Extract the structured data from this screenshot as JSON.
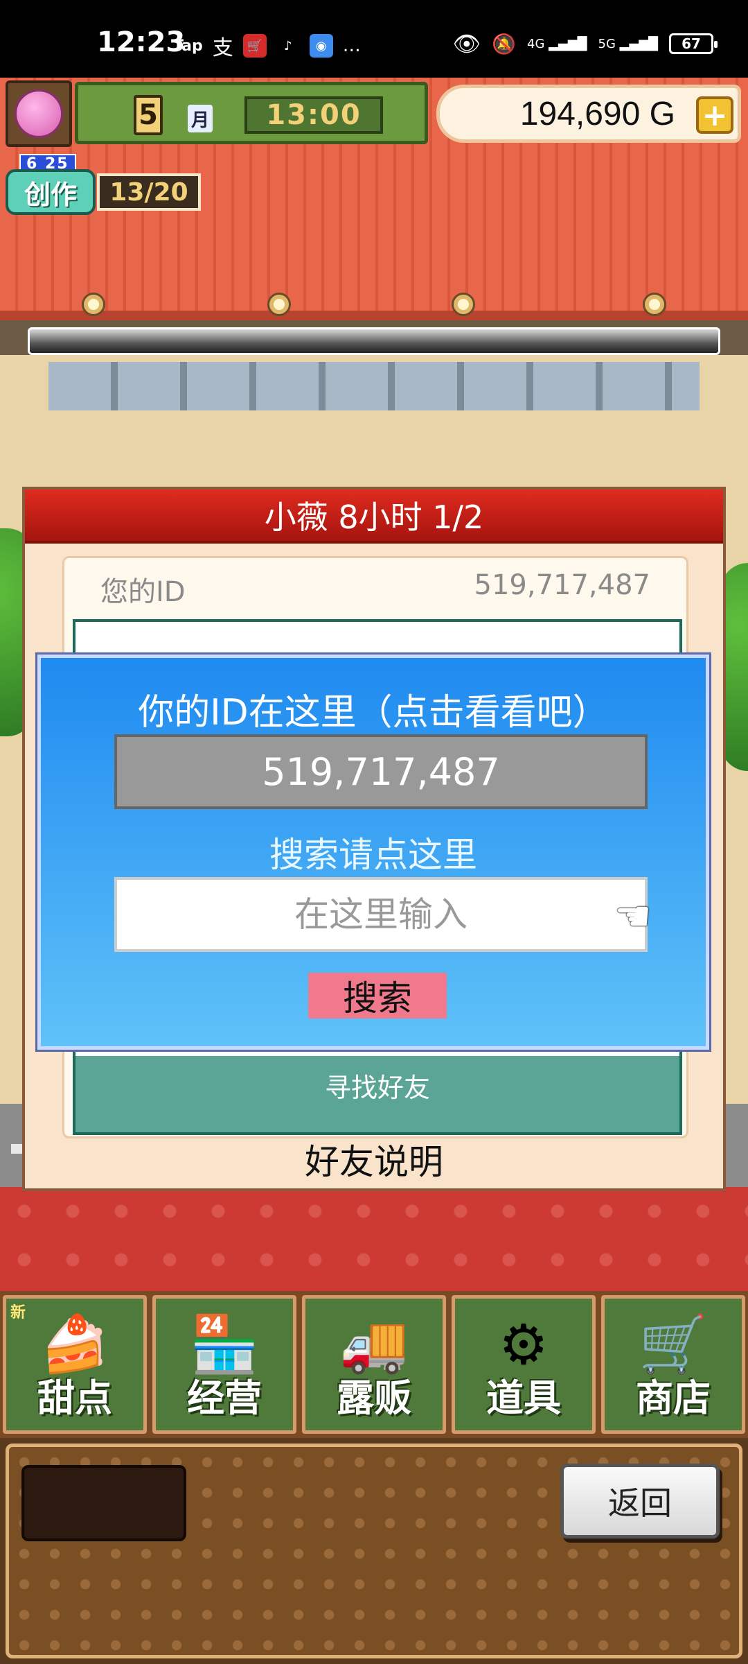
{
  "status_bar": {
    "time": "12:23",
    "left_icons": [
      "Tap",
      "支",
      "cart",
      "tiktok",
      "browser",
      "…"
    ],
    "signal_1": "4G",
    "signal_2": "5G",
    "battery": "67"
  },
  "hud": {
    "month_number": "5",
    "month_label": "月",
    "clock": "13:00",
    "money": "194,690 G",
    "plus_label": "+",
    "create_date": "6 25",
    "create_label": "创作",
    "create_count": "13/20"
  },
  "friend_panel": {
    "header": "小薇  8小时 1/2",
    "id_label": "您的ID",
    "id_value": "519,717,487",
    "find_friends": "寻找好友",
    "explain": "好友说明"
  },
  "popup": {
    "title": "你的ID在这里（点击看看吧）",
    "id_value": "519,717,487",
    "search_label": "搜索请点这里",
    "input_placeholder": "在这里输入",
    "search_button": "搜索"
  },
  "menu": {
    "items": [
      {
        "label": "甜点",
        "icon": "cake-icon",
        "badge": "新"
      },
      {
        "label": "经营",
        "icon": "shop-icon"
      },
      {
        "label": "露贩",
        "icon": "food-truck-icon"
      },
      {
        "label": "道具",
        "icon": "items-icon"
      },
      {
        "label": "商店",
        "icon": "cart-icon"
      }
    ]
  },
  "bottom": {
    "back_label": "返回"
  }
}
